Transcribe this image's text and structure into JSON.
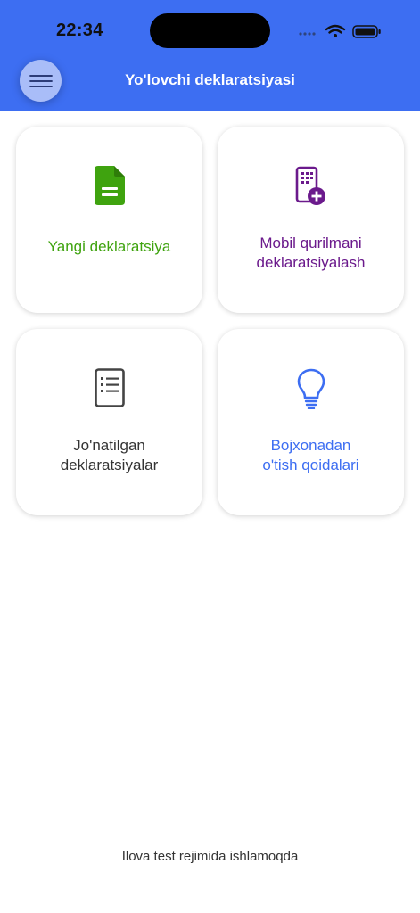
{
  "status_bar": {
    "time": "22:34"
  },
  "header": {
    "title": "Yo'lovchi deklaratsiyasi",
    "background_color": "#3d6ef2",
    "menu_icon": "hamburger-menu-icon"
  },
  "cards": [
    {
      "icon": "document-icon",
      "color": "#3fa30f",
      "label_lines": [
        "Yangi deklaratsiya"
      ]
    },
    {
      "icon": "mobile-device-add-icon",
      "color": "#6b1a8c",
      "label_lines": [
        "Mobil qurilmani",
        "deklaratsiyalash"
      ]
    },
    {
      "icon": "list-document-icon",
      "color": "#444444",
      "label_lines": [
        "Jo'natilgan",
        "deklaratsiyalar"
      ]
    },
    {
      "icon": "lightbulb-icon",
      "color": "#3d6ef2",
      "label_lines": [
        "Bojxonadan",
        "o'tish qoidalari"
      ]
    }
  ],
  "footer": {
    "text": "Ilova test rejimida ishlamoqda"
  }
}
